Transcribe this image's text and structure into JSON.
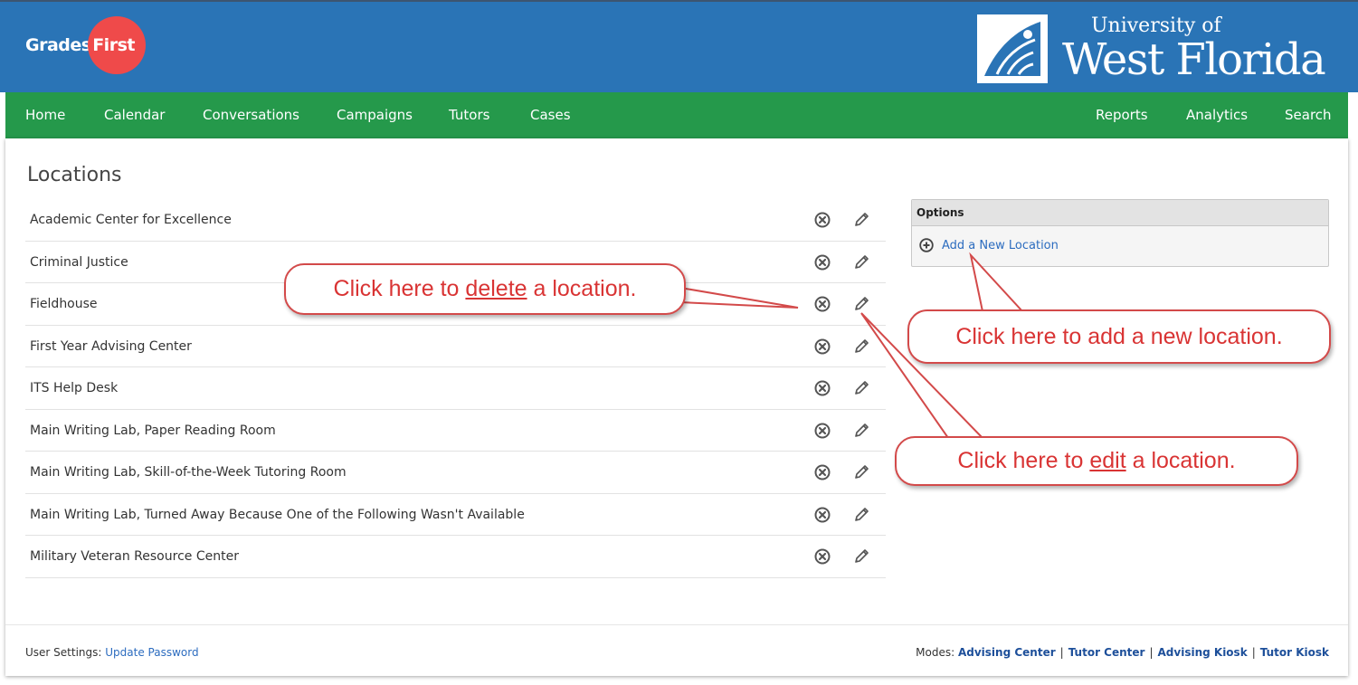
{
  "brand": {
    "product_word1": "Grades",
    "product_word2": "First",
    "university_line1": "University of",
    "university_line2": "West Florida"
  },
  "nav": {
    "left": [
      "Home",
      "Calendar",
      "Conversations",
      "Campaigns",
      "Tutors",
      "Cases"
    ],
    "right": [
      "Reports",
      "Analytics",
      "Search"
    ]
  },
  "page": {
    "title": "Locations"
  },
  "locations": [
    "Academic Center for Excellence",
    "Criminal Justice",
    "Fieldhouse",
    "First Year Advising Center",
    "ITS Help Desk",
    "Main Writing Lab, Paper Reading Room",
    "Main Writing Lab, Skill-of-the-Week Tutoring Room",
    "Main Writing Lab, Turned Away Because One of the Following Wasn't Available",
    "Military Veteran Resource Center"
  ],
  "row_icons": {
    "delete": "circle-x-icon",
    "edit": "pencil-icon"
  },
  "options": {
    "header": "Options",
    "add_label": "Add a New Location",
    "add_icon": "circle-plus-icon"
  },
  "footer": {
    "settings_label": "User Settings:",
    "update_password": "Update Password",
    "modes_label": "Modes:",
    "modes": [
      "Advising Center",
      "Tutor Center",
      "Advising Kiosk",
      "Tutor Kiosk"
    ]
  },
  "callouts": {
    "delete": {
      "before": "Click here to ",
      "keyword": "delete",
      "after": " a location."
    },
    "add": {
      "text": "Click here to add a new location."
    },
    "edit": {
      "before": "Click here to ",
      "keyword": "edit",
      "after": " a location."
    }
  },
  "colors": {
    "header_blue": "#2a74b6",
    "nav_green": "#25994b",
    "logo_red": "#ef4a4a",
    "callout_red": "#d34a4a",
    "link_blue": "#2c6cbf"
  }
}
